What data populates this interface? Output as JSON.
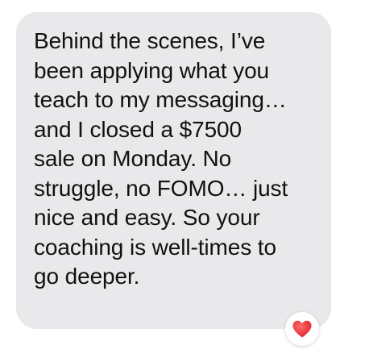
{
  "message": {
    "lines": [
      "Behind the scenes, I’ve",
      "been applying what you",
      "teach to my messaging…",
      "and I closed a $7500",
      "sale on Monday. No",
      "struggle, no FOMO… just",
      "nice and easy. So your",
      "coaching is well-times to",
      "go deeper."
    ]
  },
  "reaction": {
    "icon": "heart-icon",
    "color": "#e8303a"
  },
  "colors": {
    "bubble": "#e9e9eb",
    "text": "#111111",
    "background": "#ffffff"
  }
}
